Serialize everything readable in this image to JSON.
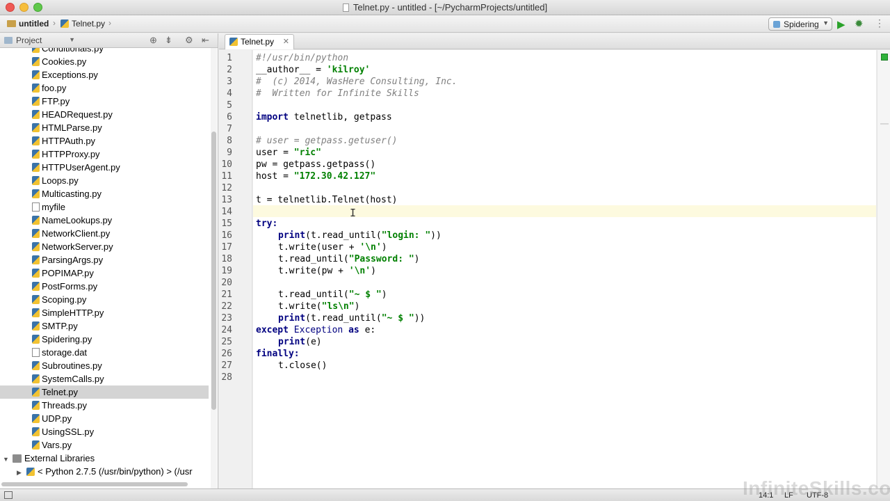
{
  "window": {
    "title": "Telnet.py - untitled - [~/PycharmProjects/untitled]"
  },
  "navbar": {
    "crumbs": [
      "untitled",
      "Telnet.py"
    ],
    "run_config": "Spidering"
  },
  "project_panel": {
    "selector_label": "Project",
    "files": [
      "Conditionals.py",
      "Cookies.py",
      "Exceptions.py",
      "foo.py",
      "FTP.py",
      "HEADRequest.py",
      "HTMLParse.py",
      "HTTPAuth.py",
      "HTTPProxy.py",
      "HTTPUserAgent.py",
      "Loops.py",
      "Multicasting.py",
      "myfile",
      "NameLookups.py",
      "NetworkClient.py",
      "NetworkServer.py",
      "ParsingArgs.py",
      "POPIMAP.py",
      "PostForms.py",
      "Scoping.py",
      "SimpleHTTP.py",
      "SMTP.py",
      "Spidering.py",
      "storage.dat",
      "Subroutines.py",
      "SystemCalls.py",
      "Telnet.py",
      "Threads.py",
      "UDP.py",
      "UsingSSL.py",
      "Vars.py"
    ],
    "selected_file": "Telnet.py",
    "external_libraries": "External Libraries",
    "python_sdk": "< Python 2.7.5 (/usr/bin/python) >  (/usr"
  },
  "editor": {
    "tab_label": "Telnet.py",
    "line_numbers": [
      "1",
      "2",
      "3",
      "4",
      "5",
      "6",
      "7",
      "8",
      "9",
      "10",
      "11",
      "12",
      "13",
      "14",
      "15",
      "16",
      "17",
      "18",
      "19",
      "20",
      "21",
      "22",
      "23",
      "24",
      "25",
      "26",
      "27",
      "28"
    ],
    "code": {
      "l1": "#!/usr/bin/python",
      "l2a": "__author__ = ",
      "l2b": "'kilroy'",
      "l3": "#  (c) 2014, WasHere Consulting, Inc.",
      "l4": "#  Written for Infinite Skills",
      "l6a": "import",
      "l6b": " telnetlib, getpass",
      "l8": "# user = getpass.getuser()",
      "l9a": "user = ",
      "l9b": "\"ric\"",
      "l10": "pw = getpass.getpass()",
      "l11a": "host = ",
      "l11b": "\"172.30.42.127\"",
      "l13": "t = telnetlib.Telnet(host)",
      "l15": "try:",
      "l16a": "print",
      "l16b": "(t.read_until(",
      "l16c": "\"login: \"",
      "l16d": "))",
      "l17a": "t.write(user + ",
      "l17b": "'\\n'",
      "l17c": ")",
      "l18a": "t.read_until(",
      "l18b": "\"Password: \"",
      "l18c": ")",
      "l19a": "t.write(pw + ",
      "l19b": "'\\n'",
      "l19c": ")",
      "l21a": "t.read_until(",
      "l21b": "\"~ $ \"",
      "l21c": ")",
      "l22a": "t.write(",
      "l22b": "\"ls\\n\"",
      "l22c": ")",
      "l23a": "print",
      "l23b": "(t.read_until(",
      "l23c": "\"~ $ \"",
      "l23d": "))",
      "l24a": "except ",
      "l24b": "Exception",
      "l24c": " as ",
      "l24d": "e:",
      "l25a": "print",
      "l25b": "(e)",
      "l26": "finally:",
      "l27": "t.close()"
    }
  },
  "statusbar": {
    "position": "14:1",
    "line_sep": "LF",
    "encoding": "UTF-8"
  },
  "watermark": "InfiniteSkills.com"
}
